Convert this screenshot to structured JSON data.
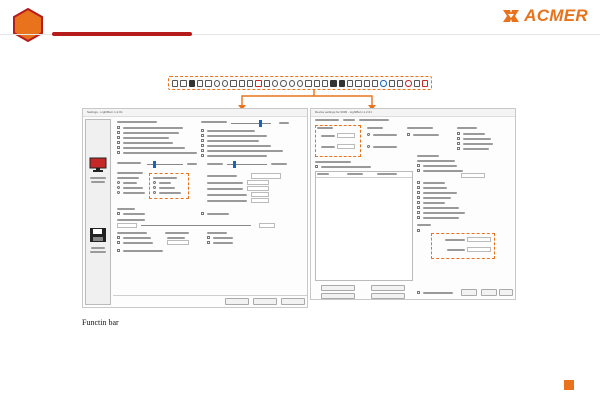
{
  "brand": {
    "name": "ACMER",
    "color": "#e8731c"
  },
  "accent": {
    "badge": "#e8731c",
    "bar": "#b71c1c"
  },
  "caption": "Functin bar",
  "left_window": {
    "title": "Settings - LightBurn 1.2.01"
  },
  "right_window": {
    "title": "Device settings for 0000 - LightBurn 1.2.01"
  },
  "icons": [
    "hexagon-badge-icon",
    "acmer-logo-icon",
    "toolbar-icons",
    "monitor-icon",
    "floppy-disk-icon"
  ]
}
